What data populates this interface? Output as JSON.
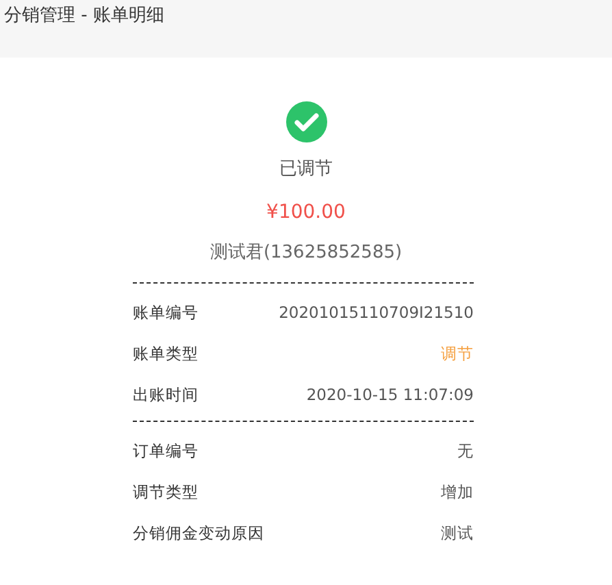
{
  "header": {
    "title": "分销管理 - 账单明细"
  },
  "summary": {
    "status": "已调节",
    "amount": "¥100.00",
    "person": "测试君(13625852585)"
  },
  "sections": [
    {
      "rows": [
        {
          "label": "账单编号",
          "value": "20201015110709I21510",
          "kind": "plain"
        },
        {
          "label": "账单类型",
          "value": "调节",
          "kind": "accent"
        },
        {
          "label": "出账时间",
          "value": "2020-10-15 11:07:09",
          "kind": "plain"
        }
      ]
    },
    {
      "rows": [
        {
          "label": "订单编号",
          "value": "无",
          "kind": "plain"
        },
        {
          "label": "调节类型",
          "value": "增加",
          "kind": "plain"
        },
        {
          "label": "分销佣金变动原因",
          "value": "测试",
          "kind": "plain"
        }
      ]
    }
  ]
}
